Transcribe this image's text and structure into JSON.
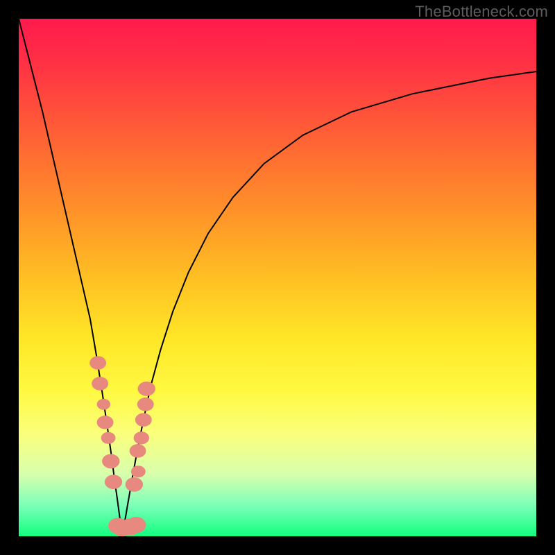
{
  "watermark": "TheBottleneck.com",
  "colors": {
    "frame": "#000000",
    "curve_stroke": "#000000",
    "marker_fill": "#e8897f",
    "gradient_stops": [
      "#ff1a4d",
      "#ff2f45",
      "#ff5838",
      "#ff8a2a",
      "#ffbf23",
      "#ffe727",
      "#fff942",
      "#fbff7a",
      "#d8ffad",
      "#7cffb9",
      "#12ff7e"
    ]
  },
  "chart_data": {
    "type": "line",
    "title": "",
    "xlabel": "",
    "ylabel": "",
    "xlim": [
      0,
      100
    ],
    "ylim": [
      0,
      100
    ],
    "vertex_x": 20,
    "series": [
      {
        "name": "left-branch",
        "x": [
          0.0,
          2.3,
          4.6,
          6.9,
          9.2,
          11.5,
          13.8,
          15.0,
          16.1,
          17.0,
          18.0,
          18.5,
          19.0,
          19.5,
          20.0
        ],
        "values": [
          100,
          91,
          82,
          72,
          62,
          52,
          42,
          35,
          28,
          22,
          15,
          11,
          7.5,
          3.8,
          0.4
        ]
      },
      {
        "name": "right-branch",
        "x": [
          20.0,
          20.6,
          21.2,
          21.9,
          22.8,
          24.0,
          25.5,
          27.4,
          29.8,
          32.8,
          36.6,
          41.4,
          47.4,
          54.9,
          64.3,
          76.1,
          90.9,
          100.0
        ],
        "values": [
          0.4,
          3.5,
          7.0,
          11.0,
          16.0,
          22.0,
          29.0,
          36.0,
          43.5,
          51.0,
          58.5,
          65.5,
          72.0,
          77.5,
          82.0,
          85.5,
          88.5,
          89.8
        ]
      }
    ],
    "markers": {
      "name": "highlighted-points",
      "x": [
        15.3,
        15.7,
        16.4,
        16.7,
        17.3,
        17.8,
        18.3,
        19.2,
        20.0,
        21.5,
        22.7,
        22.3,
        23.1,
        23.0,
        23.7,
        24.1,
        24.5,
        24.7
      ],
      "values": [
        33.5,
        29.5,
        25.5,
        22.0,
        19.0,
        14.5,
        10.5,
        2.0,
        1.5,
        1.8,
        2.2,
        10.0,
        12.5,
        16.5,
        19.0,
        22.5,
        25.5,
        28.5
      ],
      "r": [
        1.6,
        1.6,
        1.3,
        1.6,
        1.4,
        1.7,
        1.7,
        1.9,
        1.9,
        2.0,
        1.9,
        1.7,
        1.4,
        1.6,
        1.5,
        1.6,
        1.6,
        1.7
      ]
    }
  }
}
